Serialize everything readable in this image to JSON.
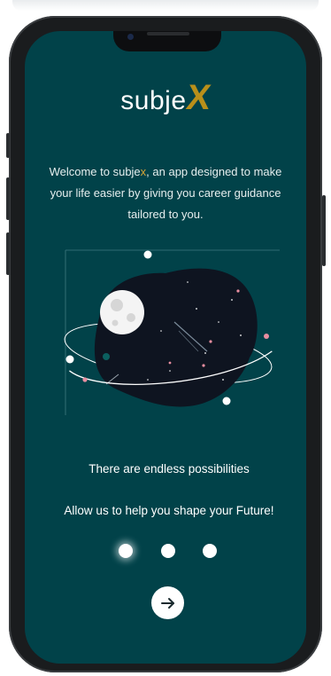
{
  "app": {
    "logo_prefix": "subje",
    "logo_suffix": "X"
  },
  "intro": {
    "welcome_prefix": "Welcome to subje",
    "welcome_accent": "x",
    "welcome_rest": ", an app designed to make your life easier by giving you career guidance tailored to you."
  },
  "onboarding": {
    "tagline": "There are endless possibilities",
    "subline": "Allow us to help you shape your Future!",
    "page_count": 3,
    "current_page": 1
  },
  "icons": {
    "next": "arrow-right-icon",
    "illustration": "planet-illustration"
  },
  "colors": {
    "background": "#014249",
    "accent": "#b98f1a",
    "text": "#ffffff",
    "planet": "#0e1420"
  }
}
